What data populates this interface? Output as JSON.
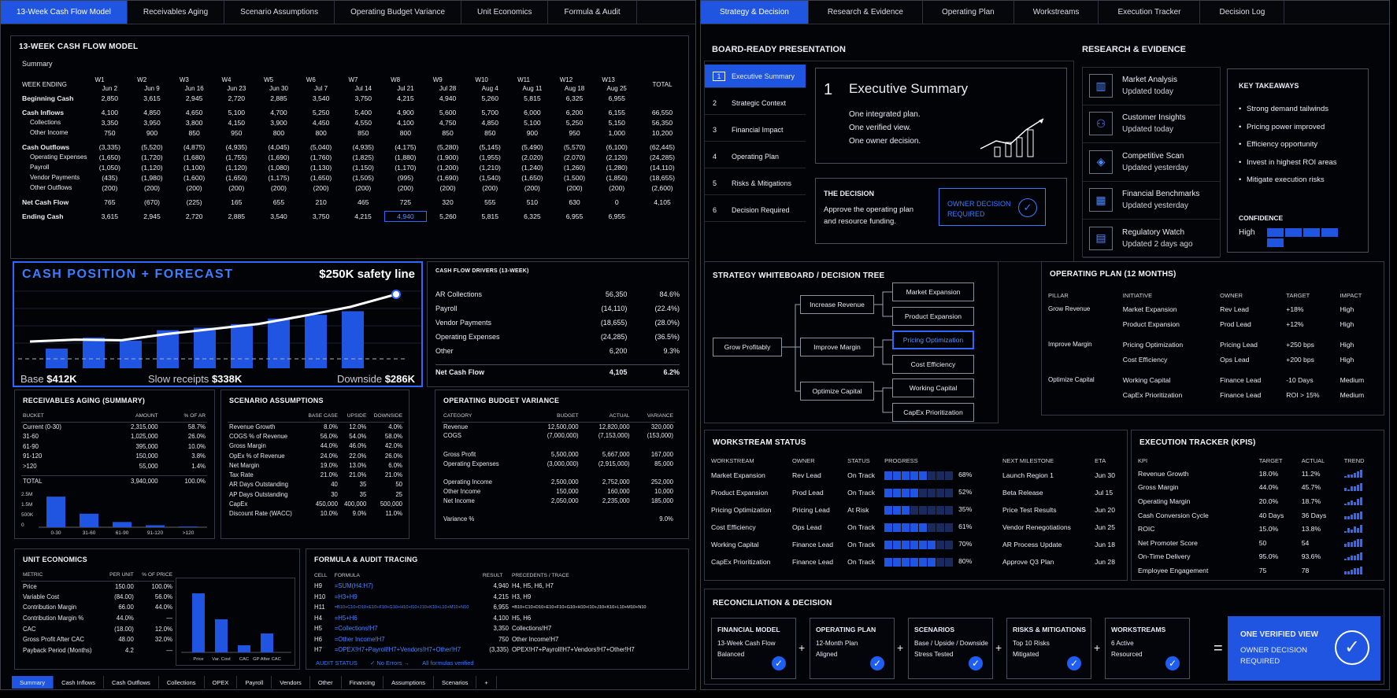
{
  "left_tabs": [
    "13-Week Cash Flow Model",
    "Receivables Aging",
    "Scenario Assumptions",
    "Operating Budget Variance",
    "Unit Economics",
    "Formula & Audit"
  ],
  "right_tabs": [
    "Strategy & Decision",
    "Research & Evidence",
    "Operating Plan",
    "Workstreams",
    "Execution Tracker",
    "Decision Log"
  ],
  "cashflow": {
    "title": "13-WEEK CASH FLOW MODEL",
    "subtitle": "Summary",
    "week_ending_label": "WEEK ENDING",
    "total_label": "TOTAL",
    "weeks": [
      [
        "W1",
        "Jun 2"
      ],
      [
        "W2",
        "Jun 9"
      ],
      [
        "W3",
        "Jun 16"
      ],
      [
        "W4",
        "Jun 23"
      ],
      [
        "W5",
        "Jun 30"
      ],
      [
        "W6",
        "Jul 7"
      ],
      [
        "W7",
        "Jul 14"
      ],
      [
        "W8",
        "Jul 21"
      ],
      [
        "W9",
        "Jul 28"
      ],
      [
        "W10",
        "Aug 4"
      ],
      [
        "W11",
        "Aug 11"
      ],
      [
        "W12",
        "Aug 18"
      ],
      [
        "W13",
        "Aug 25"
      ]
    ],
    "rows": [
      {
        "label": "Beginning Cash",
        "bold": true,
        "values": [
          "2,850",
          "3,615",
          "2,945",
          "2,720",
          "2,885",
          "3,540",
          "3,750",
          "4,215",
          "4,940",
          "5,260",
          "5,815",
          "6,325",
          "6,955",
          ""
        ]
      },
      {
        "label": "Cash Inflows",
        "bold": true,
        "gap": true,
        "values": [
          "4,100",
          "4,850",
          "4,650",
          "5,100",
          "4,700",
          "5,250",
          "5,400",
          "4,900",
          "5,600",
          "5,700",
          "6,000",
          "6,200",
          "6,155",
          "66,550"
        ]
      },
      {
        "label": "Collections",
        "ind": true,
        "values": [
          "3,350",
          "3,950",
          "3,800",
          "4,150",
          "3,900",
          "4,450",
          "4,550",
          "4,100",
          "4,750",
          "4,850",
          "5,100",
          "5,250",
          "5,150",
          "56,350"
        ]
      },
      {
        "label": "Other Income",
        "ind": true,
        "values": [
          "750",
          "900",
          "850",
          "950",
          "800",
          "800",
          "850",
          "800",
          "850",
          "850",
          "900",
          "950",
          "1,000",
          "10,200"
        ]
      },
      {
        "label": "Cash Outflows",
        "bold": true,
        "gap": true,
        "values": [
          "(3,335)",
          "(5,520)",
          "(4,875)",
          "(4,935)",
          "(4,045)",
          "(5,040)",
          "(4,935)",
          "(4,175)",
          "(5,280)",
          "(5,145)",
          "(5,490)",
          "(5,570)",
          "(6,100)",
          "(62,445)"
        ]
      },
      {
        "label": "Operating Expenses",
        "ind": true,
        "values": [
          "(1,650)",
          "(1,720)",
          "(1,680)",
          "(1,755)",
          "(1,690)",
          "(1,760)",
          "(1,825)",
          "(1,880)",
          "(1,900)",
          "(1,955)",
          "(2,020)",
          "(2,070)",
          "(2,120)",
          "(24,285)"
        ]
      },
      {
        "label": "Payroll",
        "ind": true,
        "values": [
          "(1,050)",
          "(1,120)",
          "(1,100)",
          "(1,120)",
          "(1,080)",
          "(1,130)",
          "(1,150)",
          "(1,170)",
          "(1,200)",
          "(1,210)",
          "(1,240)",
          "(1,260)",
          "(1,280)",
          "(14,110)"
        ]
      },
      {
        "label": "Vendor Payments",
        "ind": true,
        "values": [
          "(435)",
          "(1,980)",
          "(1,600)",
          "(1,650)",
          "(1,175)",
          "(1,650)",
          "(1,505)",
          "(995)",
          "(1,690)",
          "(1,540)",
          "(1,650)",
          "(1,500)",
          "(1,850)",
          "(18,655)"
        ]
      },
      {
        "label": "Other Outflows",
        "ind": true,
        "values": [
          "(200)",
          "(200)",
          "(200)",
          "(200)",
          "(200)",
          "(200)",
          "(200)",
          "(200)",
          "(200)",
          "(200)",
          "(200)",
          "(200)",
          "(200)",
          "(2,600)"
        ]
      },
      {
        "label": "Net Cash Flow",
        "bold": true,
        "gap": true,
        "values": [
          "765",
          "(670)",
          "(225)",
          "165",
          "655",
          "210",
          "465",
          "725",
          "320",
          "555",
          "510",
          "630",
          "0",
          "4,105"
        ]
      },
      {
        "label": "Ending Cash",
        "bold": true,
        "gap": true,
        "values": [
          "3,615",
          "2,945",
          "2,720",
          "2,885",
          "3,540",
          "3,750",
          "4,215",
          "4,940",
          "5,260",
          "5,815",
          "6,325",
          "6,955",
          "6,955",
          ""
        ]
      }
    ]
  },
  "cash_position": {
    "title": "CASH POSITION + FORECAST",
    "safety": "$250K safety line",
    "base_label": "Base",
    "base": "$412K",
    "slow_label": "Slow receipts",
    "slow": "$338K",
    "down_label": "Downside",
    "down": "$286K"
  },
  "chart_data": [
    {
      "type": "bar",
      "title": "CASH POSITION + FORECAST",
      "values": [
        0.32,
        0.5,
        0.45,
        0.62,
        0.66,
        0.72,
        0.81,
        0.87,
        0.93
      ],
      "line": [
        0.25,
        0.28,
        0.27,
        0.37,
        0.45,
        0.53,
        0.66,
        0.8,
        1.0
      ],
      "ylim": [
        0,
        1
      ]
    },
    {
      "type": "bar",
      "title": "RECEIVABLES AGING",
      "categories": [
        "0-30",
        "31-60",
        "61-90",
        "91-120",
        ">120"
      ],
      "values": [
        2315000,
        1025000,
        395000,
        150000,
        55000
      ],
      "ylim": [
        0,
        2500000
      ],
      "yticks": [
        "2.5M",
        "1.5M",
        "500K",
        "0"
      ]
    },
    {
      "type": "bar",
      "title": "UNIT ECONOMICS",
      "categories": [
        "Price",
        "Var. Cost",
        "CAC",
        "GP After CAC"
      ],
      "values": [
        150,
        84,
        18,
        48
      ],
      "ylim": [
        0,
        160
      ]
    }
  ],
  "drivers": {
    "title": "CASH FLOW DRIVERS (13-WEEK)",
    "rows": [
      [
        "AR Collections",
        "56,350",
        "84.6%"
      ],
      [
        "Payroll",
        "(14,110)",
        "(22.4%)"
      ],
      [
        "Vendor Payments",
        "(18,655)",
        "(28.0%)"
      ],
      [
        "Operating Expenses",
        "(24,285)",
        "(36.5%)"
      ],
      [
        "Other",
        "6,200",
        "9.3%"
      ]
    ],
    "net": [
      "Net Cash Flow",
      "4,105",
      "6.2%"
    ]
  },
  "aging": {
    "title": "RECEIVABLES AGING (SUMMARY)",
    "headers": [
      "BUCKET",
      "AMOUNT",
      "% OF AR"
    ],
    "rows": [
      [
        "Current (0-30)",
        "2,315,000",
        "58.7%"
      ],
      [
        "31-60",
        "1,025,000",
        "26.0%"
      ],
      [
        "61-90",
        "395,000",
        "10.0%"
      ],
      [
        "91-120",
        "150,000",
        "3.8%"
      ],
      [
        ">120",
        "55,000",
        "1.4%"
      ]
    ],
    "total": [
      "TOTAL",
      "3,940,000",
      "100.0%"
    ]
  },
  "scenario": {
    "title": "SCENARIO ASSUMPTIONS",
    "headers": [
      "",
      "BASE CASE",
      "UPSIDE",
      "DOWNSIDE"
    ],
    "rows": [
      [
        "Revenue Growth",
        "8.0%",
        "12.0%",
        "4.0%"
      ],
      [
        "COGS % of Revenue",
        "56.0%",
        "54.0%",
        "58.0%"
      ],
      [
        "Gross Margin",
        "44.0%",
        "46.0%",
        "42.0%"
      ],
      [
        "OpEx % of Revenue",
        "24.0%",
        "22.0%",
        "26.0%"
      ],
      [
        "Net Margin",
        "19.0%",
        "13.0%",
        "6.0%"
      ],
      [
        "Tax Rate",
        "21.0%",
        "21.0%",
        "21.0%"
      ],
      [
        "AR Days Outstanding",
        "40",
        "35",
        "50"
      ],
      [
        "AP Days Outstanding",
        "30",
        "35",
        "25"
      ],
      [
        "CapEx",
        "450,000",
        "400,000",
        "500,000"
      ],
      [
        "Discount Rate (WACC)",
        "10.0%",
        "9.0%",
        "11.0%"
      ]
    ]
  },
  "budget": {
    "title": "OPERATING BUDGET VARIANCE",
    "headers": [
      "CATEGORY",
      "BUDGET",
      "ACTUAL",
      "VARIANCE"
    ],
    "rows": [
      [
        "Revenue",
        "12,500,000",
        "12,820,000",
        "320,000"
      ],
      [
        "COGS",
        "(7,000,000)",
        "(7,153,000)",
        "(153,000)"
      ],
      [
        "",
        "",
        "",
        ""
      ],
      [
        "Gross Profit",
        "5,500,000",
        "5,667,000",
        "167,000"
      ],
      [
        "Operating Expenses",
        "(3,000,000)",
        "(2,915,000)",
        "85,000"
      ],
      [
        "",
        "",
        "",
        ""
      ],
      [
        "Operating Income",
        "2,500,000",
        "2,752,000",
        "252,000"
      ],
      [
        "Other Income",
        "150,000",
        "160,000",
        "10,000"
      ],
      [
        "Net Income",
        "2,050,000",
        "2,235,000",
        "185,000"
      ],
      [
        "",
        "",
        "",
        ""
      ],
      [
        "Variance %",
        "",
        "",
        "9.0%"
      ]
    ]
  },
  "unit": {
    "title": "UNIT ECONOMICS",
    "headers": [
      "METRIC",
      "PER UNIT",
      "% OF PRICE"
    ],
    "rows": [
      [
        "Price",
        "150.00",
        "100.0%"
      ],
      [
        "Variable Cost",
        "(84.00)",
        "56.0%"
      ],
      [
        "Contribution Margin",
        "66.00",
        "44.0%"
      ],
      [
        "Contribution Margin %",
        "44.0%",
        "—"
      ],
      [
        "CAC",
        "(18.00)",
        "12.0%"
      ],
      [
        "Gross Profit After CAC",
        "48.00",
        "32.0%"
      ],
      [
        "Payback Period (Months)",
        "4.2",
        "—"
      ]
    ]
  },
  "formula": {
    "title": "FORMULA & AUDIT TRACING",
    "headers": [
      "CELL",
      "FORMULA",
      "RESULT",
      "PRECEDENTS / TRACE"
    ],
    "rows": [
      [
        "H9",
        "=SUM(H4:H7)",
        "4,940",
        "H4, H5, H6, H7"
      ],
      [
        "H10",
        "=H3+H9",
        "4,215",
        "H3, H9"
      ],
      [
        "H11",
        "=B10+C10+D10+E10+F10+G10+H10+I10+J10+K10+L10+M10+N10",
        "6,955",
        "=B10+C10+D10+E10+F10+G10+H10+I10+J10+K10+L10+M10+N10"
      ],
      [
        "H4",
        "=H5+H6",
        "4,100",
        "H5, H6"
      ],
      [
        "H5",
        "=Collections!H7",
        "3,350",
        "Collections!H7"
      ],
      [
        "H6",
        "=Other Income!H7",
        "750",
        "Other Income!H7"
      ],
      [
        "H7",
        "=OPEX!H7+Payroll!H7+Vendors!H7+Other!H7",
        "(3,335)",
        "OPEX!H7+Payroll!H7+Vendors!H7+Other!H7"
      ]
    ],
    "audit_label": "AUDIT STATUS",
    "audit_errors": "✓ No Errors →",
    "audit_verified": "All formulas verified"
  },
  "sheet_tabs": [
    "Summary",
    "Cash Inflows",
    "Cash Outflows",
    "Collections",
    "OPEX",
    "Payroll",
    "Vendors",
    "Other",
    "Financing",
    "Assumptions",
    "Scenarios",
    "+"
  ],
  "board": {
    "title": "BOARD-READY PRESENTATION",
    "nav": [
      [
        "1",
        "Executive Summary"
      ],
      [
        "2",
        "Strategic Context"
      ],
      [
        "3",
        "Financial Impact"
      ],
      [
        "4",
        "Operating Plan"
      ],
      [
        "5",
        "Risks & Mitigations"
      ],
      [
        "6",
        "Decision Required"
      ]
    ],
    "slide_num": "1",
    "slide_title": "Executive Summary",
    "slide_lines": [
      "One integrated plan.",
      "One verified view.",
      "One owner decision."
    ],
    "decision_title": "THE DECISION",
    "decision_text1": "Approve the operating plan",
    "decision_text2": "and resource funding.",
    "owner_line1": "OWNER DECISION",
    "owner_line2": "REQUIRED"
  },
  "research": {
    "title": "RESEARCH & EVIDENCE",
    "items": [
      {
        "icon": "chart-icon",
        "glyph": "▥",
        "title": "Market Analysis",
        "sub": "Updated today"
      },
      {
        "icon": "person-icon",
        "glyph": "⚇",
        "title": "Customer Insights",
        "sub": "Updated today"
      },
      {
        "icon": "compass-icon",
        "glyph": "◈",
        "title": "Competitive Scan",
        "sub": "Updated yesterday"
      },
      {
        "icon": "building-icon",
        "glyph": "▦",
        "title": "Financial Benchmarks",
        "sub": "Updated yesterday"
      },
      {
        "icon": "document-icon",
        "glyph": "▤",
        "title": "Regulatory Watch",
        "sub": "Updated 2 days ago"
      }
    ],
    "takeaways_title": "KEY TAKEAWAYS",
    "takeaways": [
      "Strong demand tailwinds",
      "Pricing power improved",
      "Efficiency opportunity",
      "Invest in highest ROI areas",
      "Mitigate execution risks"
    ],
    "confidence_label": "CONFIDENCE",
    "confidence_value": "High",
    "confidence_level": 1.0
  },
  "tree": {
    "title": "STRATEGY WHITEBOARD / DECISION TREE",
    "root": "Grow Profitably",
    "branches": [
      "Increase Revenue",
      "Improve Margin",
      "Optimize Capital"
    ],
    "leaves": [
      "Market Expansion",
      "Product Expansion",
      "Pricing Optimization",
      "Cost Efficiency",
      "Working Capital",
      "CapEx Prioritization"
    ]
  },
  "opplan": {
    "title": "OPERATING PLAN (12 MONTHS)",
    "headers": [
      "PILLAR",
      "INITIATIVE",
      "OWNER",
      "TARGET",
      "IMPACT"
    ],
    "rows": [
      [
        "Grow Revenue",
        "Market Expansion",
        "Rev Lead",
        "+18%",
        "High"
      ],
      [
        "",
        "Product Expansion",
        "Prod Lead",
        "+12%",
        "High"
      ],
      [
        "Improve Margin",
        "Pricing Optimization",
        "Pricing Lead",
        "+250 bps",
        "High"
      ],
      [
        "",
        "Cost Efficiency",
        "Ops Lead",
        "+200 bps",
        "High"
      ],
      [
        "Optimize Capital",
        "Working Capital",
        "Finance Lead",
        "-10 Days",
        "Medium"
      ],
      [
        "",
        "CapEx Prioritization",
        "Finance Lead",
        "ROI > 15%",
        "Medium"
      ]
    ]
  },
  "workstream": {
    "title": "WORKSTREAM STATUS",
    "headers": [
      "WORKSTREAM",
      "OWNER",
      "STATUS",
      "PROGRESS",
      "NEXT MILESTONE",
      "ETA"
    ],
    "rows": [
      {
        "name": "Market Expansion",
        "owner": "Rev Lead",
        "status": "On Track",
        "pct": "68%",
        "p": 0.68,
        "next": "Launch Region 1",
        "eta": "Jun 30"
      },
      {
        "name": "Product Expansion",
        "owner": "Prod Lead",
        "status": "On Track",
        "pct": "52%",
        "p": 0.52,
        "next": "Beta Release",
        "eta": "Jul 15"
      },
      {
        "name": "Pricing Optimization",
        "owner": "Pricing Lead",
        "status": "At Risk",
        "pct": "35%",
        "p": 0.35,
        "next": "Price Test Results",
        "eta": "Jun 20"
      },
      {
        "name": "Cost Efficiency",
        "owner": "Ops Lead",
        "status": "On Track",
        "pct": "61%",
        "p": 0.61,
        "next": "Vendor Renegotiations",
        "eta": "Jun 25"
      },
      {
        "name": "Working Capital",
        "owner": "Finance Lead",
        "status": "On Track",
        "pct": "70%",
        "p": 0.7,
        "next": "AR Process Update",
        "eta": "Jun 18"
      },
      {
        "name": "CapEx Prioritization",
        "owner": "Finance Lead",
        "status": "On Track",
        "pct": "80%",
        "p": 0.8,
        "next": "Approve Q3 Plan",
        "eta": "Jun 28"
      }
    ]
  },
  "kpi": {
    "title": "EXECUTION TRACKER (KPIS)",
    "headers": [
      "KPI",
      "TARGET",
      "ACTUAL",
      "TREND"
    ],
    "rows": [
      [
        "Revenue Growth",
        "18.0%",
        "11.2%"
      ],
      [
        "Gross Margin",
        "44.0%",
        "45.7%"
      ],
      [
        "Operating Margin",
        "20.0%",
        "18.7%"
      ],
      [
        "Cash Conversion Cycle",
        "40 Days",
        "36 Days"
      ],
      [
        "ROIC",
        "15.0%",
        "13.8%"
      ],
      [
        "Net Promoter Score",
        "50",
        "54"
      ],
      [
        "On-Time Delivery",
        "95.0%",
        "93.6%"
      ],
      [
        "Employee Engagement",
        "75",
        "78"
      ]
    ]
  },
  "recon": {
    "title": "RECONCILIATION & DECISION",
    "boxes": [
      [
        "FINANCIAL MODEL",
        "13-Week Cash Flow",
        "Balanced"
      ],
      [
        "OPERATING PLAN",
        "12-Month Plan",
        "Aligned"
      ],
      [
        "SCENARIOS",
        "Base / Upside / Downside",
        "Stress Tested"
      ],
      [
        "RISKS & MITIGATIONS",
        "Top 10 Risks",
        "Mitigated"
      ],
      [
        "WORKSTREAMS",
        "6 Active",
        "Resourced"
      ]
    ],
    "plus": "+",
    "equals": "=",
    "final1": "ONE VERIFIED VIEW",
    "final2": "OWNER DECISION",
    "final3": "REQUIRED"
  }
}
